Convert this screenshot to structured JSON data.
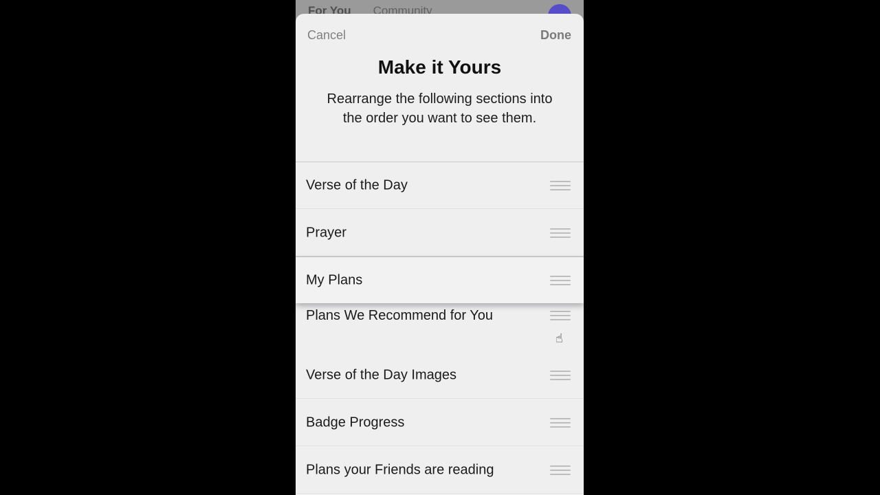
{
  "background_tabs": [
    "For You",
    "Community"
  ],
  "sheet": {
    "cancel_label": "Cancel",
    "done_label": "Done",
    "title": "Make it Yours",
    "subtitle": "Rearrange the following sections into the order you want to see them."
  },
  "sections": [
    {
      "label": "Verse of the Day",
      "handle_icon": "drag-handle-icon"
    },
    {
      "label": "Prayer",
      "handle_icon": "drag-handle-icon"
    },
    {
      "label": "My Plans",
      "handle_icon": "drag-handle-icon",
      "state": "dragging"
    },
    {
      "label": "Plans We Recommend for You",
      "handle_icon": "drag-handle-icon"
    },
    {
      "label": "Verse of the Day Images",
      "handle_icon": "drag-handle-icon"
    },
    {
      "label": "Badge Progress",
      "handle_icon": "drag-handle-icon"
    },
    {
      "label": "Plans your Friends are reading",
      "handle_icon": "drag-handle-icon"
    }
  ],
  "colors": {
    "sheet_bg": "#efeff0",
    "avatar": "#4b3fd0",
    "handle": "#bdbdbd"
  }
}
